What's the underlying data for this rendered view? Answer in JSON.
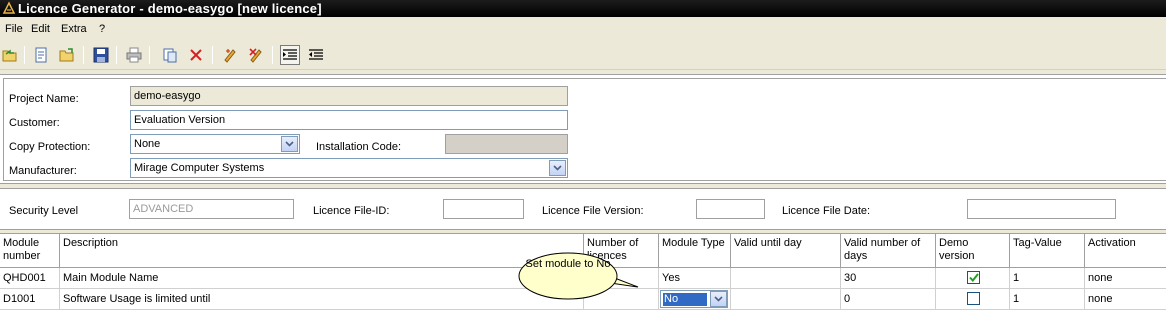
{
  "window": {
    "title": "Licence Generator - demo-easygo [new licence]"
  },
  "menu": {
    "items": [
      "File",
      "Edit",
      "Extra",
      "?"
    ]
  },
  "toolbar": {
    "buttons": [
      "open-icon",
      "new-document-icon",
      "open-folder-icon",
      "save-icon",
      "print-icon",
      "copy-icon",
      "delete-icon",
      "edit-icon",
      "remove-icon",
      "indent-icon",
      "outdent-icon"
    ]
  },
  "form": {
    "project_name_label": "Project Name:",
    "project_name_value": "demo-easygo",
    "customer_label": "Customer:",
    "customer_value": "Evaluation Version",
    "copy_protection_label": "Copy Protection:",
    "copy_protection_value": "None",
    "installation_code_label": "Installation Code:",
    "installation_code_value": "",
    "manufacturer_label": "Manufacturer:",
    "manufacturer_value": "Mirage Computer Systems"
  },
  "security": {
    "security_level_label": "Security Level",
    "security_level_value": "ADVANCED",
    "licence_file_id_label": "Licence File-ID:",
    "licence_file_version_label": "Licence File Version:",
    "licence_file_date_label": "Licence File Date:"
  },
  "grid": {
    "headers": [
      "Module number",
      "Description",
      "Number of licences",
      "Module Type",
      "Valid until day",
      "Valid number of days",
      "Demo version",
      "Tag-Value",
      "Activation"
    ],
    "rows": [
      {
        "module": "QHD001",
        "description": "Main Module Name",
        "licences": "",
        "module_type": "Yes",
        "valid_until": "",
        "days": "30",
        "demo": true,
        "tag": "1",
        "activation": "none"
      },
      {
        "module": "D1001",
        "description": "Software Usage is limited until",
        "licences": "",
        "module_type": "No",
        "valid_until": "",
        "days": "0",
        "demo": false,
        "tag": "1",
        "activation": "none"
      }
    ]
  },
  "callout": {
    "text": "Set module to No"
  },
  "colors": {
    "title_bar": "#000000",
    "window_bg": "#ece9d8",
    "selection": "#316ac5",
    "checkmark": "#21a121"
  }
}
